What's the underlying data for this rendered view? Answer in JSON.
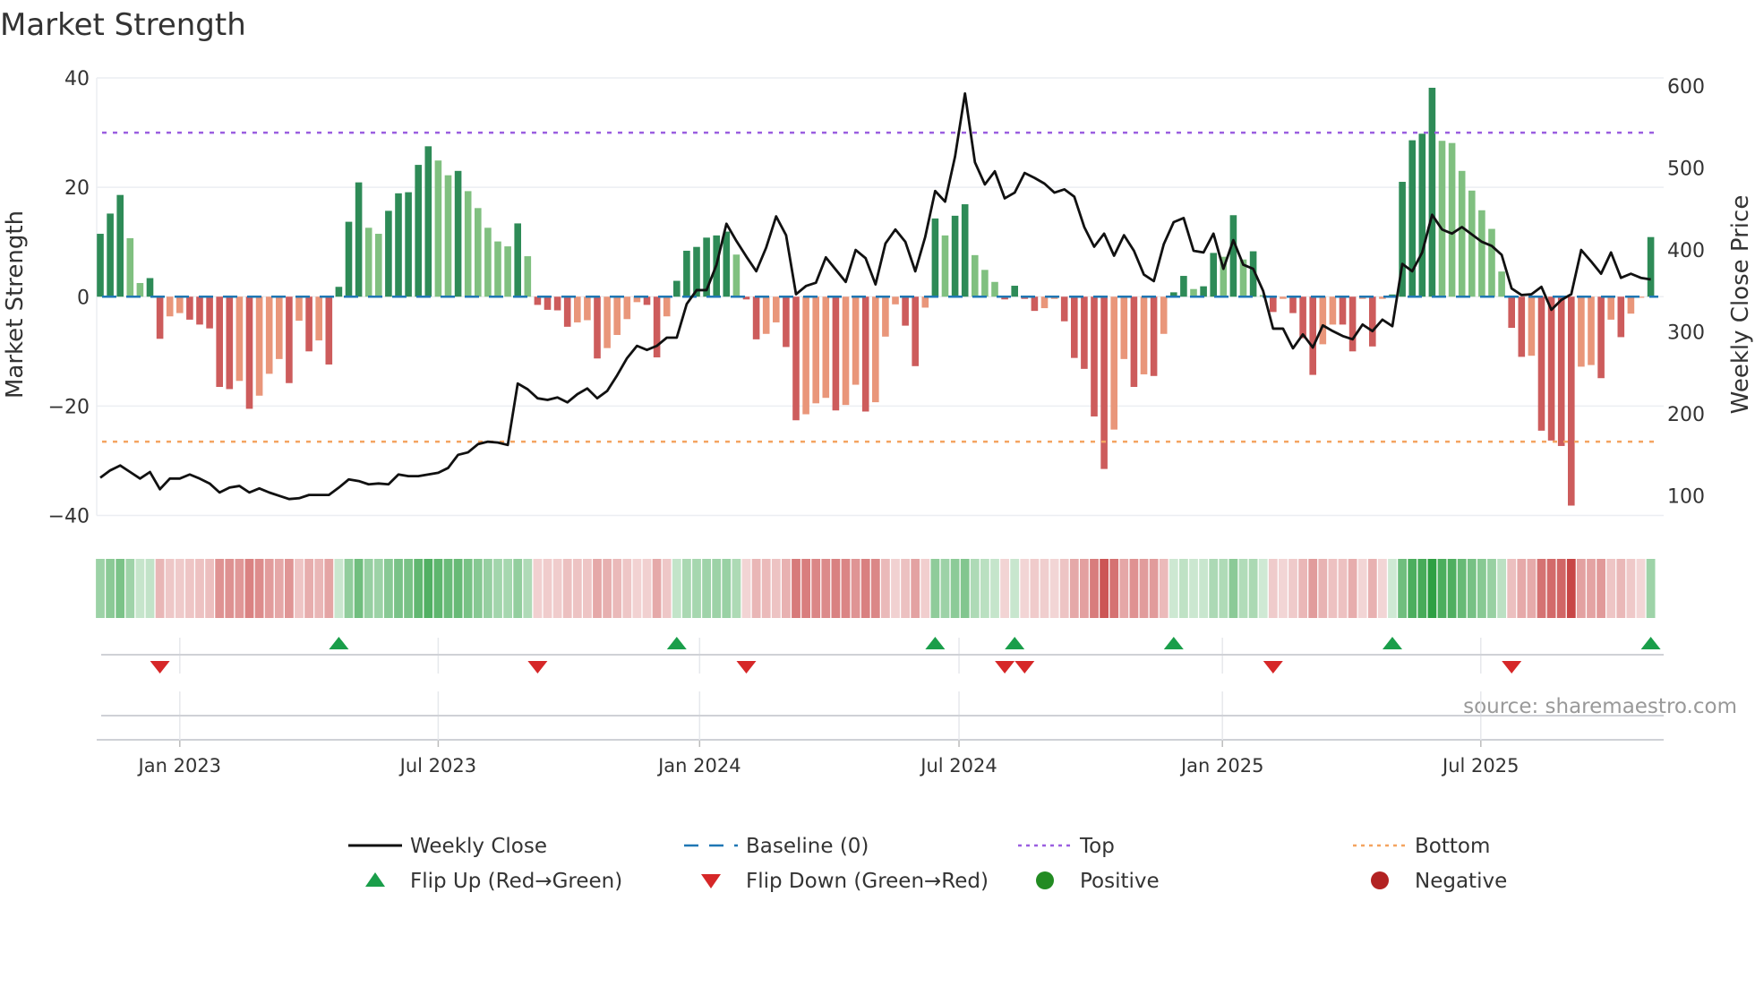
{
  "chart_data": {
    "type": "bar",
    "title": "Market Strength",
    "ylabel_left": "Market Strength",
    "ylabel_right": "Weekly Close Price",
    "ylim_left": [
      -40,
      40
    ],
    "ylim_right": [
      76,
      610
    ],
    "yticks_left": [
      40,
      20,
      0,
      -20,
      -40
    ],
    "yticks_right": [
      600,
      500,
      400,
      300,
      200,
      100
    ],
    "top_level": 30,
    "bottom_level": -26.5,
    "baseline": 0,
    "xticks": [
      {
        "label": "Jan 2023",
        "week": 9
      },
      {
        "label": "Jul 2023",
        "week": 35
      },
      {
        "label": "Jan 2024",
        "week": 61.3
      },
      {
        "label": "Jul 2024",
        "week": 87.4
      },
      {
        "label": "Jan 2025",
        "week": 113.9
      },
      {
        "label": "Jul 2025",
        "week": 139.9
      }
    ],
    "series": [
      {
        "name": "Market Strength",
        "values": [
          11.5,
          15.2,
          18.6,
          10.7,
          2.5,
          3.4,
          -7.7,
          -3.6,
          -3.0,
          -4.2,
          -5.1,
          -5.8,
          -16.5,
          -16.9,
          -15.4,
          -20.5,
          -18.1,
          -14.1,
          -11.4,
          -15.8,
          -4.4,
          -10,
          -8,
          -12.4,
          1.8,
          13.7,
          20.9,
          12.6,
          11.5,
          15.7,
          18.9,
          19.1,
          24.1,
          27.5,
          24.9,
          22.2,
          23.0,
          19.3,
          16.2,
          12.6,
          10.1,
          9.2,
          13.4,
          7.4,
          -1.5,
          -2.4,
          -2.5,
          -5.5,
          -4.7,
          -4.3,
          -11.3,
          -9.4,
          -7.0,
          -4.1,
          -1.0,
          -1.5,
          -11.1,
          -3.6,
          2.9,
          8.4,
          9.1,
          10.8,
          11.2,
          11.9,
          7.7,
          -0.5,
          -7.8,
          -6.8,
          -4.7,
          -9.2,
          -22.6,
          -21.5,
          -19.5,
          -18.5,
          -20.8,
          -19.8,
          -16.1,
          -21,
          -19.3,
          -7.3,
          -1.4,
          -5.3,
          -12.7,
          -2.0,
          14.3,
          11.2,
          14.8,
          16.9,
          7.6,
          4.9,
          2.7,
          -0.5,
          2.0,
          -0.4,
          -2.6,
          -2.1,
          -0.4,
          -4.5,
          -11.2,
          -13.2,
          -21.9,
          -31.5,
          -24.3,
          -11.4,
          -16.5,
          -14.2,
          -14.5,
          -6.8,
          0.8,
          3.8,
          1.4,
          1.9,
          8.0,
          7.3,
          14.9,
          6.8,
          8.3,
          0.3,
          -2.8,
          -0.4,
          -3.0,
          -7.6,
          -14.3,
          -8.7,
          -5.1,
          -5.1,
          -10,
          -0.4,
          -9.1,
          -0.4,
          0.4,
          21.0,
          28.6,
          29.8,
          38.2,
          28.5,
          28.1,
          23.0,
          19.4,
          15.8,
          12.4,
          4.6,
          -5.7,
          -11.0,
          -10.8,
          -24.5,
          -26.3,
          -27.3,
          -38.2,
          -12.8,
          -12.5,
          -14.9,
          -4.2,
          -7.4,
          -3.1,
          -0.2,
          10.9
        ]
      },
      {
        "name": "Weekly Close",
        "values": [
          122,
          131,
          137,
          129,
          121,
          129,
          108,
          121,
          121,
          126,
          121,
          115,
          104,
          110,
          112,
          104,
          109,
          104,
          100,
          96,
          97,
          101,
          101,
          101,
          110,
          120,
          118,
          114,
          115,
          114,
          126,
          124,
          124,
          126,
          128,
          134,
          150,
          153,
          163,
          166,
          165,
          162,
          237,
          230,
          219,
          217,
          220,
          214,
          224,
          231,
          219,
          228,
          247,
          268,
          283,
          278,
          283,
          293,
          293,
          334,
          351,
          351,
          382,
          432,
          411,
          392,
          374,
          403,
          441,
          418,
          346,
          356,
          360,
          391,
          376,
          361,
          400,
          390,
          358,
          408,
          425,
          410,
          374,
          416,
          472,
          459,
          514,
          591,
          507,
          480,
          496,
          463,
          470,
          494,
          488,
          481,
          470,
          474,
          465,
          428,
          404,
          420,
          393,
          418,
          399,
          370,
          362,
          407,
          434,
          439,
          399,
          397,
          420,
          377,
          412,
          382,
          377,
          350,
          304,
          304,
          280,
          297,
          281,
          308,
          301,
          295,
          291,
          309,
          301,
          315,
          307,
          383,
          374,
          397,
          443,
          425,
          420,
          428,
          419,
          410,
          405,
          394,
          353,
          345,
          346,
          355,
          327,
          339,
          346,
          400,
          386,
          371,
          397,
          366,
          371,
          366,
          364
        ]
      }
    ],
    "colors": {
      "pos_strong": "#2e8b57",
      "pos_weak": "#80c080",
      "neg_strong": "#cd5c5c",
      "neg_weak": "#e9967a",
      "close": "#111111",
      "baseline": "#1f77b4",
      "top": "#9b5fe0",
      "bottom": "#f4a460",
      "flip_up": "#1a9e4a",
      "flip_down": "#d62728",
      "positive": "#228b22",
      "negative": "#b22222"
    },
    "legend": [
      {
        "label": "Weekly Close",
        "kind": "line"
      },
      {
        "label": "Baseline (0)",
        "kind": "baseline"
      },
      {
        "label": "Top",
        "kind": "top"
      },
      {
        "label": "Bottom",
        "kind": "bottom"
      },
      {
        "label": "Flip Up (Red→Green)",
        "kind": "up"
      },
      {
        "label": "Flip Down (Green→Red)",
        "kind": "down"
      },
      {
        "label": "Positive",
        "kind": "pos"
      },
      {
        "label": "Negative",
        "kind": "neg"
      }
    ],
    "legend_placement": "bottom",
    "source": "source: sharemaestro.com"
  }
}
